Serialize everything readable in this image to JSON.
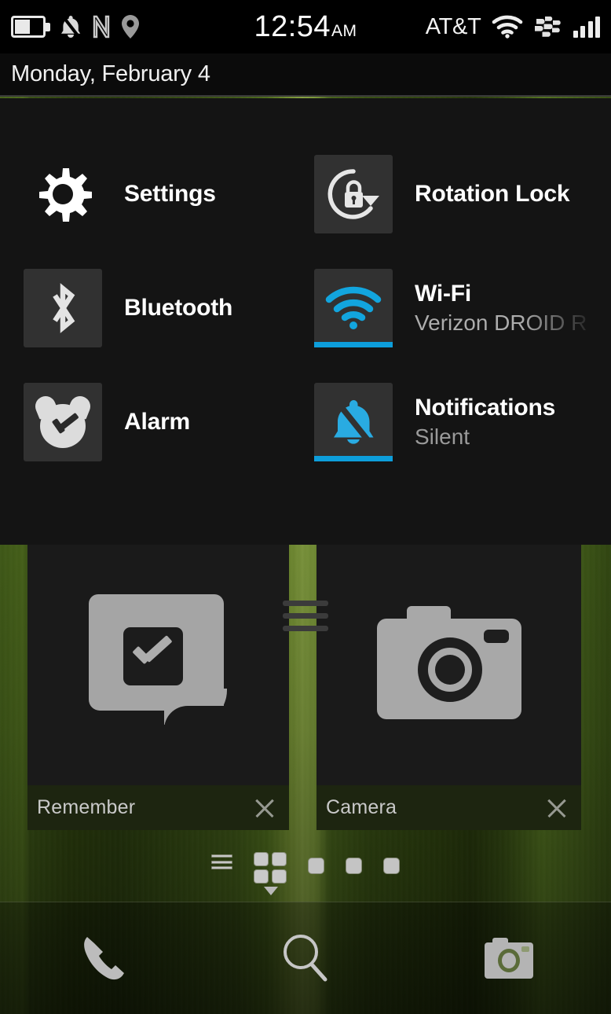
{
  "statusbar": {
    "icons_left": [
      "battery-icon",
      "notifications-muted-icon",
      "nfc-icon",
      "location-pin-icon"
    ],
    "clock_time": "12:54",
    "clock_period": "AM",
    "carrier": "AT&T",
    "icons_right": [
      "wifi-icon",
      "blackberry-logo-icon",
      "signal-bars-icon"
    ],
    "battery_level_pct": 45,
    "signal_bars": 4
  },
  "date_header": {
    "date": "Monday, February 4"
  },
  "quick_settings": {
    "items": [
      {
        "id": "settings",
        "label": "Settings",
        "sublabel": "",
        "icon": "gear-icon",
        "tile": false,
        "active": false
      },
      {
        "id": "rotation-lock",
        "label": "Rotation Lock",
        "sublabel": "",
        "icon": "rotation-lock-icon",
        "tile": true,
        "active": false
      },
      {
        "id": "bluetooth",
        "label": "Bluetooth",
        "sublabel": "",
        "icon": "bluetooth-icon",
        "tile": true,
        "active": false
      },
      {
        "id": "wifi",
        "label": "Wi-Fi",
        "sublabel": "Verizon DROID R",
        "icon": "wifi-icon",
        "tile": true,
        "active": true
      },
      {
        "id": "alarm",
        "label": "Alarm",
        "sublabel": "",
        "icon": "alarm-clock-icon",
        "tile": true,
        "active": false
      },
      {
        "id": "notifications",
        "label": "Notifications",
        "sublabel": "Silent",
        "icon": "bell-muted-icon",
        "tile": true,
        "active": true
      }
    ],
    "active_color": "#0d9edb",
    "tile_color": "#313131",
    "panel_color": "#141414"
  },
  "active_frames": [
    {
      "id": "remember",
      "title": "Remember",
      "icon": "note-checkmark-icon",
      "close_label": "close-icon"
    },
    {
      "id": "camera",
      "title": "Camera",
      "icon": "camera-icon",
      "close_label": "close-icon"
    }
  ],
  "page_indicators": {
    "items": [
      "list-view-icon",
      "grid-view-icon",
      "page-dot",
      "page-dot",
      "page-dot"
    ],
    "active_index": 1
  },
  "dock": {
    "items": [
      {
        "id": "phone",
        "icon": "phone-icon"
      },
      {
        "id": "search",
        "icon": "search-icon"
      },
      {
        "id": "camera",
        "icon": "camera-icon"
      }
    ]
  }
}
